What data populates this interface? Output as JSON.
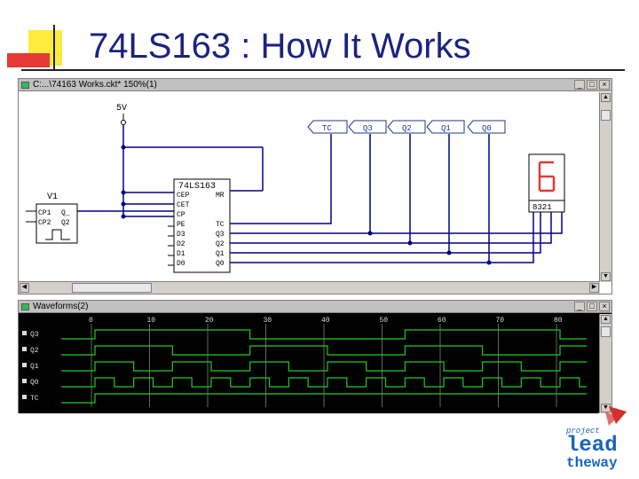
{
  "slide": {
    "title": "74LS163 : How It Works"
  },
  "schematic_window": {
    "title": "C:...\\74163 Works.ckt* 150%(1)",
    "power_label": "5V",
    "source_name": "V1",
    "source_pins": [
      "CP1",
      "CP2",
      "Q_",
      "Q2"
    ],
    "chip_name": "74LS163",
    "chip_left_pins": [
      "CEP",
      "CET",
      "CP",
      "PE",
      "D3",
      "D2",
      "D1",
      "D0"
    ],
    "chip_right_pins": [
      "MR",
      "TC",
      "Q3",
      "Q2",
      "Q1",
      "Q0"
    ],
    "probes": [
      "TC",
      "Q3",
      "Q2",
      "Q1",
      "Q0"
    ],
    "display_label": "8321"
  },
  "waveform_window": {
    "title": "Waveforms(2)",
    "ticks": [
      "0",
      "10",
      "20",
      "30",
      "40",
      "50",
      "60",
      "70",
      "80"
    ],
    "signals": [
      "Q3",
      "Q2",
      "Q1",
      "Q0",
      "TC"
    ]
  },
  "logo": {
    "line1": "project",
    "line2": "lead",
    "line3": "theway"
  },
  "colors": {
    "title": "#1a237e",
    "wire": "#000080",
    "probe": "#1e3a8a",
    "wave": "#22cc22",
    "display": "#e53935",
    "logo_red": "#d32f2f",
    "logo_blue": "#1565c0"
  }
}
